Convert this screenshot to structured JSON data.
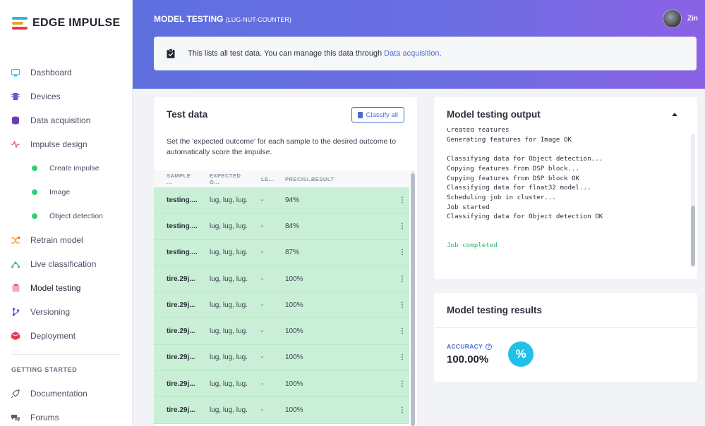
{
  "app": {
    "logo_text": "EDGE IMPULSE"
  },
  "header": {
    "title": "MODEL TESTING",
    "project": "(LUG-NUT-COUNTER)",
    "user": "Zin"
  },
  "info": {
    "text": "This lists all test data. You can manage this data through",
    "link": "Data acquisition",
    "suffix": "."
  },
  "sidebar": {
    "items": [
      {
        "label": "Dashboard",
        "icon": "monitor-icon",
        "color": "#21c0e8"
      },
      {
        "label": "Devices",
        "icon": "chip-icon",
        "color": "#5a5fd8"
      },
      {
        "label": "Data acquisition",
        "icon": "database-icon",
        "color": "#6a3fb5"
      },
      {
        "label": "Impulse design",
        "icon": "pulse-icon",
        "color": "#e85a5a"
      }
    ],
    "subitems": [
      {
        "label": "Create impulse"
      },
      {
        "label": "Image"
      },
      {
        "label": "Object detection"
      }
    ],
    "items2": [
      {
        "label": "Retrain model",
        "icon": "shuffle-icon",
        "color": "#f0a020"
      },
      {
        "label": "Live classification",
        "icon": "network-icon",
        "color": "#2fb26a"
      },
      {
        "label": "Model testing",
        "icon": "clipboard-icon",
        "color": "#e85a7a"
      },
      {
        "label": "Versioning",
        "icon": "branch-icon",
        "color": "#5a5fd8"
      },
      {
        "label": "Deployment",
        "icon": "box-icon",
        "color": "#e8384f"
      }
    ],
    "section": "GETTING STARTED",
    "bottom": [
      {
        "label": "Documentation",
        "icon": "rocket-icon"
      },
      {
        "label": "Forums",
        "icon": "forum-icon"
      }
    ]
  },
  "test_data": {
    "title": "Test data",
    "classify_label": "Classify all",
    "description": "Set the 'expected outcome' for each sample to the desired outcome to automatically score the impulse.",
    "columns": [
      "SAMPLE ...",
      "EXPECTED O...",
      "LE...",
      "PRECISI...",
      "RESULT"
    ],
    "rows": [
      {
        "sample": "testing....",
        "expected": "lug, lug, lug...",
        "length": "-",
        "precision": "94%",
        "result": ""
      },
      {
        "sample": "testing....",
        "expected": "lug, lug, lug...",
        "length": "-",
        "precision": "84%",
        "result": ""
      },
      {
        "sample": "testing....",
        "expected": "lug, lug, lug...",
        "length": "-",
        "precision": "87%",
        "result": ""
      },
      {
        "sample": "tire.29j...",
        "expected": "lug, lug, lug...",
        "length": "-",
        "precision": "100%",
        "result": ""
      },
      {
        "sample": "tire.29j...",
        "expected": "lug, lug, lug...",
        "length": "-",
        "precision": "100%",
        "result": ""
      },
      {
        "sample": "tire.29j...",
        "expected": "lug, lug, lug...",
        "length": "-",
        "precision": "100%",
        "result": ""
      },
      {
        "sample": "tire.29j...",
        "expected": "lug, lug, lug...",
        "length": "-",
        "precision": "100%",
        "result": ""
      },
      {
        "sample": "tire.29j...",
        "expected": "lug, lug, lug...",
        "length": "-",
        "precision": "100%",
        "result": ""
      },
      {
        "sample": "tire.29j...",
        "expected": "lug, lug, lug...",
        "length": "-",
        "precision": "100%",
        "result": ""
      }
    ]
  },
  "output": {
    "title": "Model testing output",
    "lines": [
      "Created features",
      "Generating features for Image OK",
      "",
      "Classifying data for Object detection...",
      "Copying features from DSP block...",
      "Copying features from DSP block OK",
      "Classifying data for float32 model...",
      "Scheduling job in cluster...",
      "Job started",
      "Classifying data for Object detection OK",
      "",
      ""
    ],
    "done": "Job completed"
  },
  "results": {
    "title": "Model testing results",
    "accuracy_label": "ACCURACY",
    "accuracy_value": "100.00%",
    "pct_symbol": "%"
  }
}
